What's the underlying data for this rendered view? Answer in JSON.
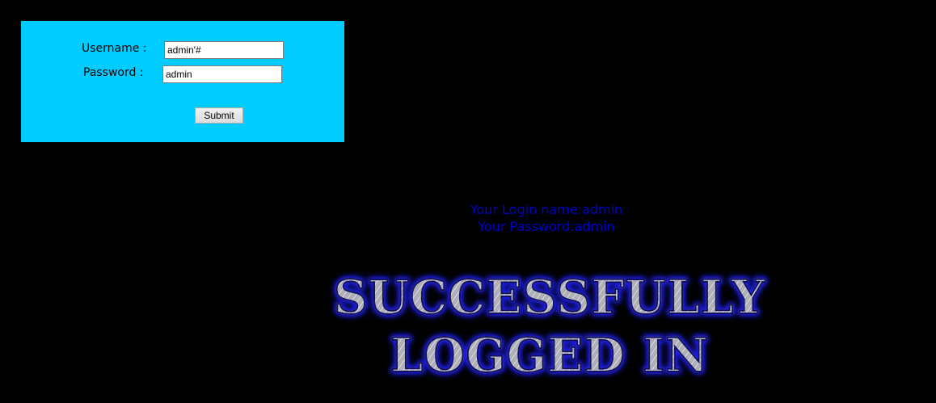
{
  "login_form": {
    "username_label": "Username :",
    "username_value": "admin'#",
    "password_label": "Password :",
    "password_value": "admin",
    "submit_label": "Submit",
    "background_color": "#00ccff"
  },
  "result": {
    "login_name_text": "Your Login name:admin",
    "password_text": "Your Password:admin",
    "text_color": "#0000cc"
  },
  "banner": {
    "line1": "SUCCESSFULLY",
    "line2": "LOGGED IN",
    "glow_color": "#2020ff"
  },
  "page": {
    "background_color": "#000000"
  }
}
